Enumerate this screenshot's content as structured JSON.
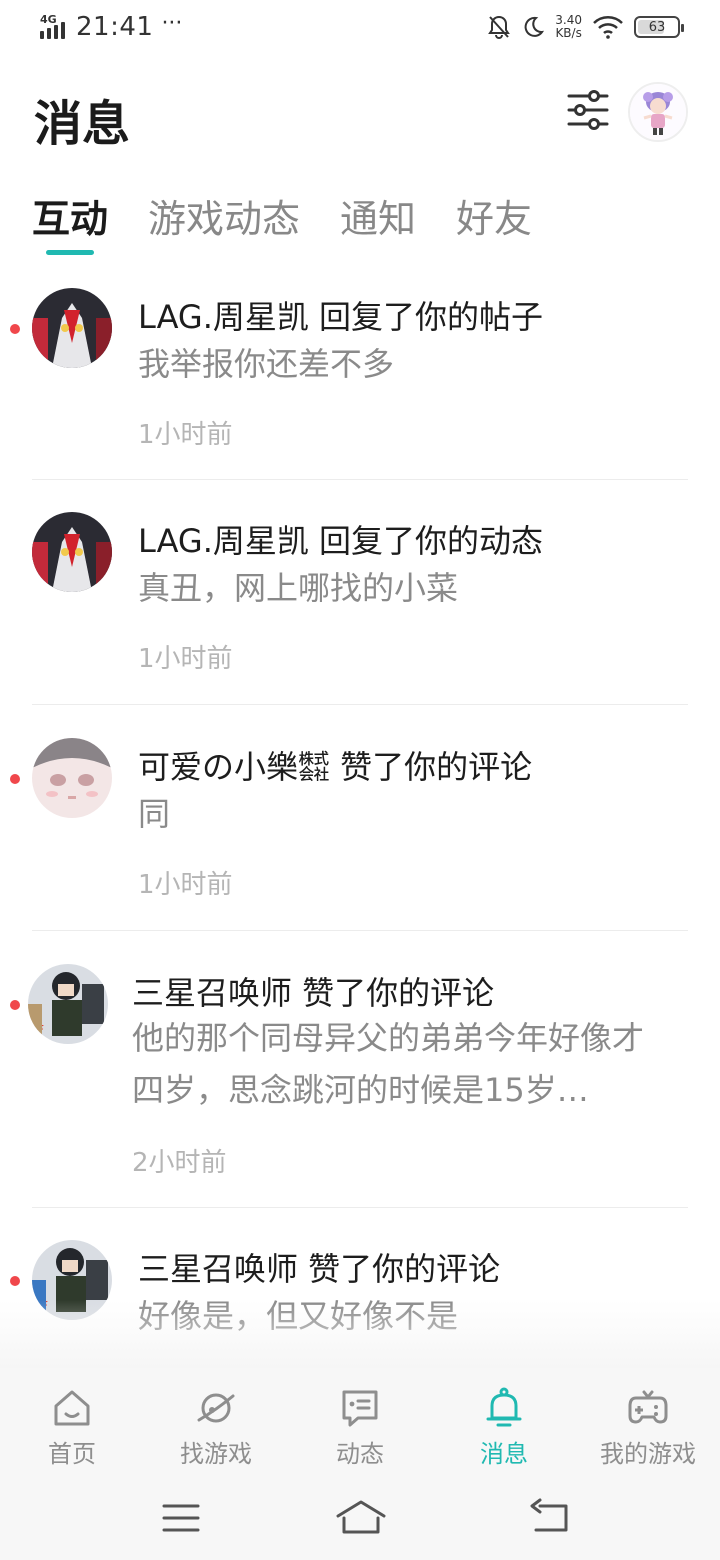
{
  "status_bar": {
    "network": "4G",
    "time": "21:41",
    "more": "···",
    "speed_value": "3.40",
    "speed_unit": "KB/s",
    "battery": "63"
  },
  "header": {
    "title": "消息",
    "filter_icon": "sliders-icon",
    "avatar_icon": "user-avatar"
  },
  "tabs": [
    {
      "label": "互动",
      "active": true
    },
    {
      "label": "游戏动态",
      "active": false
    },
    {
      "label": "通知",
      "active": false
    },
    {
      "label": "好友",
      "active": false
    }
  ],
  "messages": [
    {
      "title": "LAG.周星凯 回复了你的帖子",
      "body": "我举报你还差不多",
      "time": "1小时前",
      "unread": true
    },
    {
      "title": "LAG.周星凯 回复了你的动态",
      "body": "真丑，网上哪找的小菜",
      "time": "1小时前",
      "unread": false
    },
    {
      "title": "可爱の小樂㍿ 赞了你的评论",
      "body": "同",
      "time": "1小时前",
      "unread": true
    },
    {
      "title": "三星召唤师 赞了你的评论",
      "body": "他的那个同母异父的弟弟今年好像才四岁，思念跳河的时候是15岁…",
      "time": "2小时前",
      "unread": true
    },
    {
      "title": "三星召唤师 赞了你的评论",
      "body": "好像是，但又好像不是",
      "time": "",
      "unread": true
    }
  ],
  "bottom_nav": [
    {
      "label": "首页",
      "icon": "home-icon",
      "active": false
    },
    {
      "label": "找游戏",
      "icon": "planet-icon",
      "active": false
    },
    {
      "label": "动态",
      "icon": "chat-icon",
      "active": false
    },
    {
      "label": "消息",
      "icon": "bell-icon",
      "active": true
    },
    {
      "label": "我的游戏",
      "icon": "gamepad-icon",
      "active": false
    }
  ],
  "colors": {
    "accent": "#20b9b1",
    "unread_dot": "#f0474b"
  }
}
